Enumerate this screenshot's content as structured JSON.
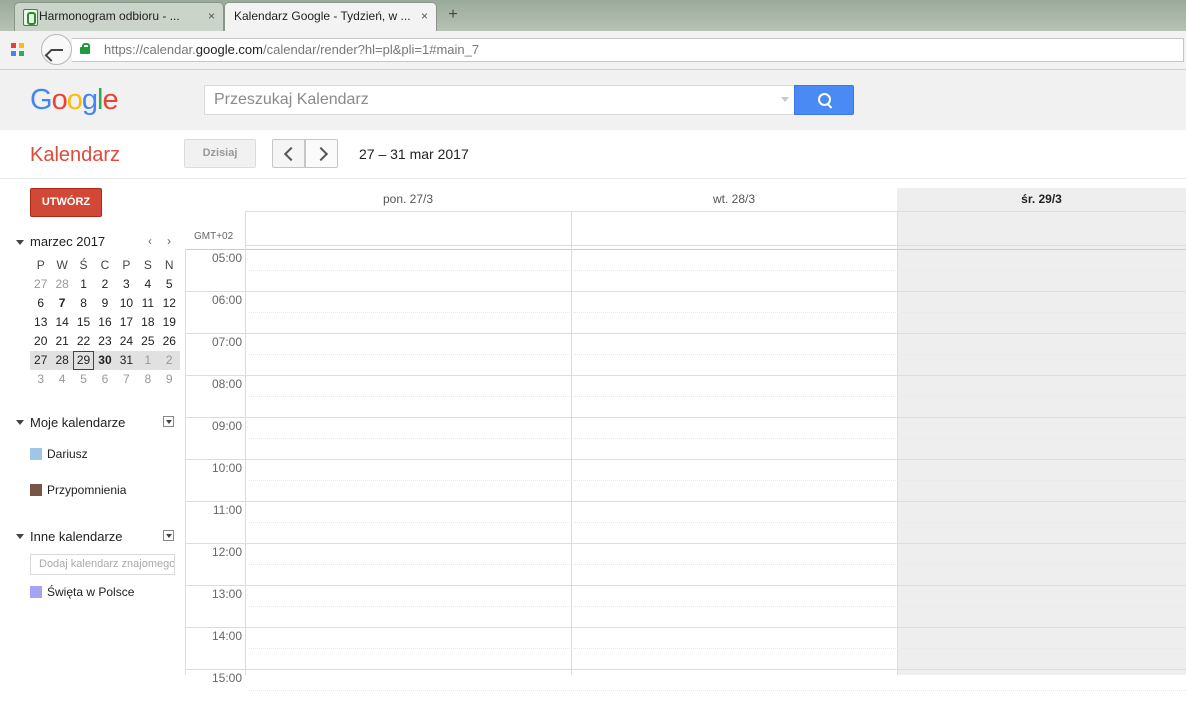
{
  "browser": {
    "tabs": [
      {
        "title": "Harmonogram odbioru - ...",
        "close": "×"
      },
      {
        "title": "Kalendarz Google - Tydzień, w ...",
        "close": "×"
      }
    ],
    "new_tab": "+",
    "url_prefix": "https://calendar.",
    "url_domain": "google.com",
    "url_path": "/calendar/render?hl=pl&pli=1#main_7"
  },
  "header": {
    "logo_letters": [
      {
        "char": "G",
        "color": "#4285f4"
      },
      {
        "char": "o",
        "color": "#ea4335"
      },
      {
        "char": "o",
        "color": "#fbbc05"
      },
      {
        "char": "g",
        "color": "#4285f4"
      },
      {
        "char": "l",
        "color": "#34a853"
      },
      {
        "char": "e",
        "color": "#ea4335"
      }
    ],
    "search_placeholder": "Przeszukaj Kalendarz"
  },
  "toolbar": {
    "app_title": "Kalendarz",
    "today_label": "Dzisiaj",
    "date_range": "27 – 31 mar 2017"
  },
  "sidebar": {
    "create_label": "UTWÓRZ",
    "mini_calendar": {
      "month_label": "marzec 2017",
      "prev": "‹",
      "next": "›",
      "weekdays": [
        "P",
        "W",
        "Ś",
        "C",
        "P",
        "S",
        "N"
      ],
      "weeks": [
        [
          {
            "d": "27",
            "out": true
          },
          {
            "d": "28",
            "out": true
          },
          {
            "d": "1"
          },
          {
            "d": "2"
          },
          {
            "d": "3"
          },
          {
            "d": "4"
          },
          {
            "d": "5"
          }
        ],
        [
          {
            "d": "6"
          },
          {
            "d": "7",
            "bold": true
          },
          {
            "d": "8"
          },
          {
            "d": "9"
          },
          {
            "d": "10"
          },
          {
            "d": "11"
          },
          {
            "d": "12"
          }
        ],
        [
          {
            "d": "13"
          },
          {
            "d": "14"
          },
          {
            "d": "15"
          },
          {
            "d": "16"
          },
          {
            "d": "17"
          },
          {
            "d": "18"
          },
          {
            "d": "19"
          }
        ],
        [
          {
            "d": "20"
          },
          {
            "d": "21"
          },
          {
            "d": "22"
          },
          {
            "d": "23"
          },
          {
            "d": "24"
          },
          {
            "d": "25"
          },
          {
            "d": "26"
          }
        ],
        [
          {
            "d": "27"
          },
          {
            "d": "28"
          },
          {
            "d": "29",
            "sel": true
          },
          {
            "d": "30",
            "bold": true
          },
          {
            "d": "31"
          },
          {
            "d": "1",
            "out": true
          },
          {
            "d": "2",
            "out": true
          }
        ],
        [
          {
            "d": "3",
            "out": true
          },
          {
            "d": "4",
            "out": true
          },
          {
            "d": "5",
            "out": true
          },
          {
            "d": "6",
            "out": true
          },
          {
            "d": "7",
            "out": true
          },
          {
            "d": "8",
            "out": true
          },
          {
            "d": "9",
            "out": true
          }
        ]
      ],
      "current_week_index": 4
    },
    "my_calendars": {
      "label": "Moje kalendarze",
      "items": [
        {
          "name": "Dariusz",
          "color": "#9fc6e7"
        },
        {
          "name": "Przypomnienia",
          "color": "#795548"
        }
      ]
    },
    "other_calendars": {
      "label": "Inne kalendarze",
      "add_placeholder": "Dodaj kalendarz znajomego",
      "items": [
        {
          "name": "Święta w Polsce",
          "color": "#a4a4f5"
        }
      ]
    }
  },
  "week": {
    "timezone": "GMT+02",
    "days": [
      {
        "label": "pon. 27/3",
        "today": false
      },
      {
        "label": "wt. 28/3",
        "today": false
      },
      {
        "label": "śr. 29/3",
        "today": true
      }
    ],
    "hours": [
      "05:00",
      "06:00",
      "07:00",
      "08:00",
      "09:00",
      "10:00",
      "11:00",
      "12:00",
      "13:00",
      "14:00",
      "15:00"
    ],
    "today_bg": "#eeeeee"
  }
}
